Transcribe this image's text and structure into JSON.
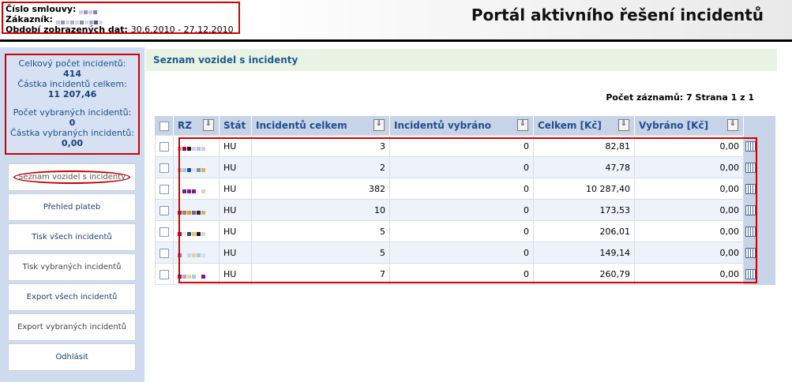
{
  "header": {
    "contract_label": "Číslo smlouvy:",
    "customer_label": "Zákazník:",
    "period_label": "Období zobrazených dat:",
    "period_value": "30.6.2010 - 27.12.2010",
    "portal_title": "Portál aktivního řešení incidentů"
  },
  "stats": {
    "total_count_label": "Celkový počet incidentů:",
    "total_count": "414",
    "total_amount_label": "Částka incidentů celkem:",
    "total_amount": "11 207,46",
    "selected_count_label": "Počet vybraných incidentů:",
    "selected_count": "0",
    "selected_amount_label": "Částka vybraných incidentů:",
    "selected_amount": "0,00"
  },
  "nav": {
    "items": [
      "Seznam vozidel s incidenty",
      "Přehled plateb",
      "Tisk všech incidentů",
      "Tisk vybraných incidentů",
      "Export všech incidentů",
      "Export vybraných incidentů",
      "Odhlásit"
    ]
  },
  "main": {
    "section_title": "Seznam vozidel s incidenty",
    "records_info": "Počet záznamů: 7 Strana 1 z 1"
  },
  "table": {
    "headers": {
      "rz": "RZ",
      "stat": "Stát",
      "total": "Incidentů celkem",
      "selected": "Incidentů vybráno",
      "amount": "Celkem [Kč]",
      "amount_selected": "Vybráno [Kč]"
    },
    "rows": [
      {
        "stat": "HU",
        "total": "3",
        "selected": "0",
        "amount": "82,81",
        "amount_selected": "0,00"
      },
      {
        "stat": "HU",
        "total": "2",
        "selected": "0",
        "amount": "47,78",
        "amount_selected": "0,00"
      },
      {
        "stat": "HU",
        "total": "382",
        "selected": "0",
        "amount": "10 287,40",
        "amount_selected": "0,00"
      },
      {
        "stat": "HU",
        "total": "10",
        "selected": "0",
        "amount": "173,53",
        "amount_selected": "0,00"
      },
      {
        "stat": "HU",
        "total": "5",
        "selected": "0",
        "amount": "206,01",
        "amount_selected": "0,00"
      },
      {
        "stat": "HU",
        "total": "5",
        "selected": "0",
        "amount": "149,14",
        "amount_selected": "0,00"
      },
      {
        "stat": "HU",
        "total": "7",
        "selected": "0",
        "amount": "260,79",
        "amount_selected": "0,00"
      }
    ]
  },
  "colors": {
    "highlight_border": "#d10000",
    "sidebar_bg": "#cfdcf0",
    "header_text": "#1f4f8f",
    "section_bg": "#e9f3e4"
  },
  "icons": [
    "sort-icon",
    "calendar-icon",
    "checkbox"
  ]
}
